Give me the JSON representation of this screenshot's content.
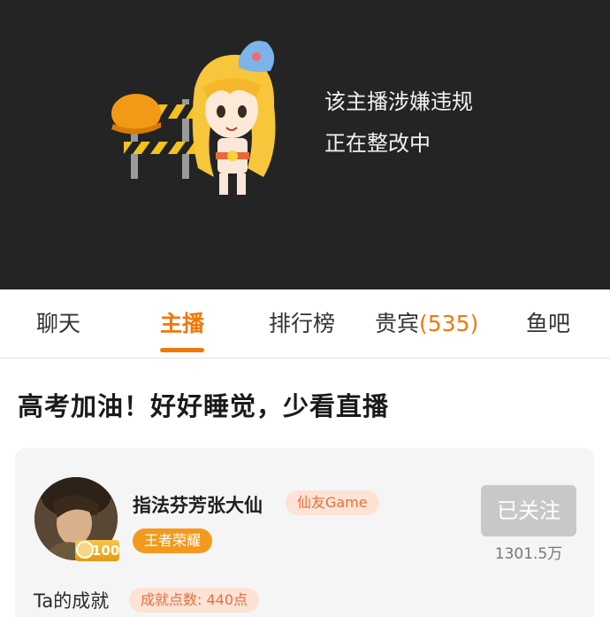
{
  "player": {
    "notice_line1": "该主播涉嫌违规",
    "notice_line2": "正在整改中"
  },
  "tabs": [
    {
      "label": "聊天",
      "active": false
    },
    {
      "label": "主播",
      "active": true
    },
    {
      "label": "排行榜",
      "active": false
    },
    {
      "label": "贵宾",
      "count": "(535)",
      "active": false
    },
    {
      "label": "鱼吧",
      "active": false
    }
  ],
  "announcement": "高考加油！好好睡觉，少看直播",
  "streamer": {
    "name": "指法芬芳张大仙",
    "org_tag": "仙友Game",
    "game_tag": "王者荣耀",
    "level": "100",
    "follow_label": "已关注",
    "followers": "1301.5万",
    "achievements_label": "Ta的成就",
    "achievement_points": "成就点数: 440点"
  },
  "colors": {
    "accent": "#f0780a",
    "banner_bg": "#242424",
    "card_bg": "#f5f5f5",
    "tag_bg": "#fde3d6",
    "tag_text": "#e3703e",
    "follow_disabled": "#c8c8c8"
  },
  "icons": {
    "mascot": "mascot-construction-icon",
    "level_badge": "level-badge-icon"
  }
}
